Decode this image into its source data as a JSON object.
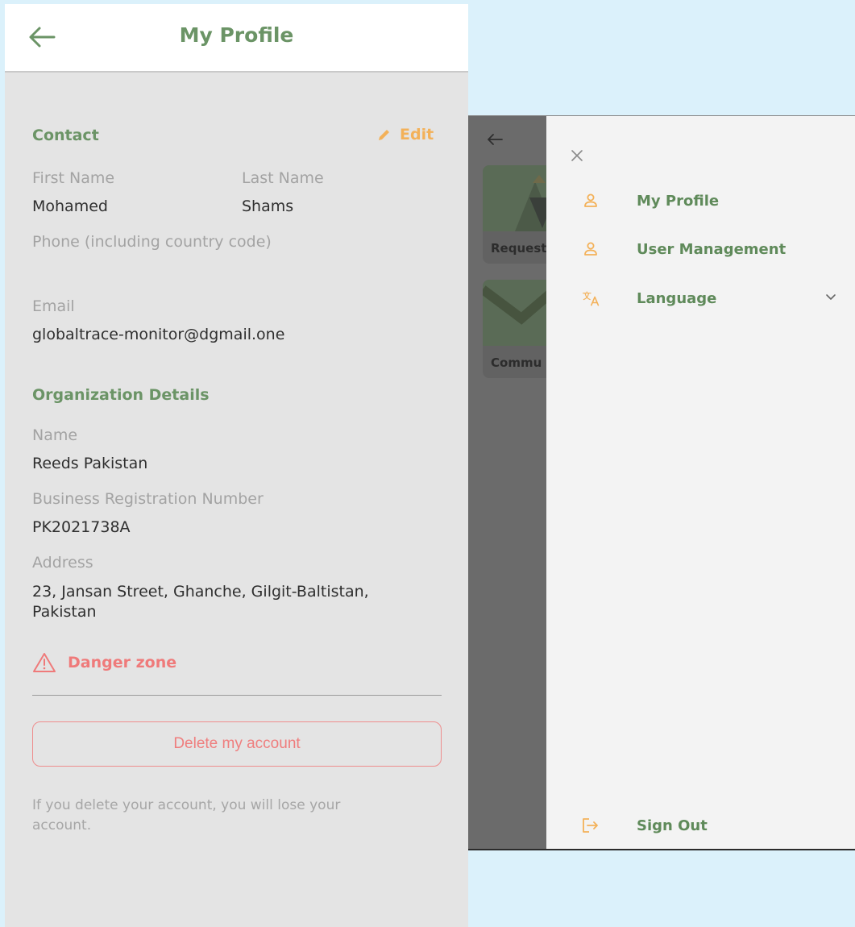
{
  "profile": {
    "title": "My Profile",
    "contact": {
      "heading": "Contact",
      "edit_label": "Edit",
      "first_name_label": "First Name",
      "first_name": "Mohamed",
      "last_name_label": "Last Name",
      "last_name": "Shams",
      "phone_label": "Phone (including country code)",
      "email_label": "Email",
      "email": "globaltrace-monitor@dgmail.one"
    },
    "organization": {
      "heading": "Organization Details",
      "name_label": "Name",
      "name": "Reeds Pakistan",
      "brn_label": "Business Registration Number",
      "brn": "PK2021738A",
      "address_label": "Address",
      "address": "23, Jansan Street, Ghanche, Gilgit-Baltistan, Pakistan"
    },
    "danger": {
      "heading": "Danger zone",
      "delete_button": "Delete my account",
      "note": "If you delete your account, you will lose your account."
    }
  },
  "drawer": {
    "background_cards": [
      "Request",
      "Commu"
    ],
    "menu": [
      {
        "label": "My Profile",
        "icon": "person-icon"
      },
      {
        "label": "User Management",
        "icon": "person-icon"
      },
      {
        "label": "Language",
        "icon": "translate-icon"
      }
    ],
    "sign_out": {
      "label": "Sign Out",
      "icon": "sign-out-icon"
    }
  },
  "colors": {
    "primary_green": "#6b9466",
    "accent_orange": "#f3b159",
    "danger_red": "#ef7a7a",
    "app_background": "#e4e4e4",
    "page_background": "#dbf1fb"
  }
}
